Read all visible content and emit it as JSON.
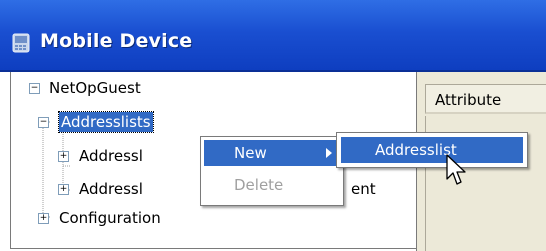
{
  "window": {
    "title": "Mobile Device"
  },
  "tree": {
    "root": "NetOpGuest",
    "items": [
      {
        "label": "Addresslists"
      },
      {
        "label": "Addressl"
      },
      {
        "label": "Addressl"
      },
      {
        "label": "Configuration"
      }
    ],
    "partial_text": "ent"
  },
  "right_panel": {
    "header": "Attribute"
  },
  "context_menu": {
    "items": [
      {
        "label": "New"
      },
      {
        "label": "Delete"
      }
    ]
  },
  "submenu": {
    "items": [
      {
        "label": "Addresslist"
      }
    ]
  },
  "colors": {
    "title_bar": "#1a4fd1",
    "selection": "#316ac5"
  }
}
